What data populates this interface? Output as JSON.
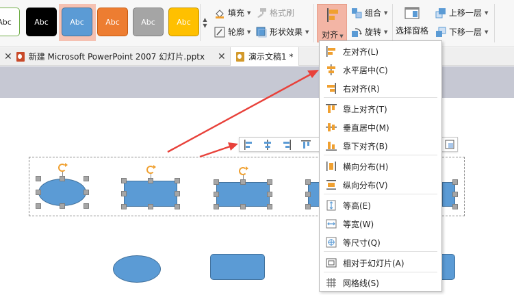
{
  "ribbon": {
    "style_tiles": [
      {
        "label": "Abc",
        "bg": "#ffffff",
        "fg": "#222222",
        "border": "#70ad47"
      },
      {
        "label": "Abc",
        "bg": "#000000",
        "fg": "#ffffff",
        "border": "#000000"
      },
      {
        "label": "Abc",
        "bg": "#5b9bd5",
        "fg": "#ffffff",
        "border": "#41719c"
      },
      {
        "label": "Abc",
        "bg": "#ed7d31",
        "fg": "#ffffff",
        "border": "#c55a11"
      },
      {
        "label": "Abc",
        "bg": "#a5a5a5",
        "fg": "#ffffff",
        "border": "#7f7f7f"
      },
      {
        "label": "Abc",
        "bg": "#ffc000",
        "fg": "#ffffff",
        "border": "#bf9000"
      }
    ],
    "fill": "填充",
    "format_brush": "格式刷",
    "outline": "轮廓",
    "shape_effects": "形状效果",
    "align": "对齐",
    "group": "组合",
    "rotate": "旋转",
    "selection_pane": "选择窗格",
    "bring_forward": "上移一层",
    "send_backward": "下移一层"
  },
  "tabs": [
    {
      "label": "新建 Microsoft PowerPoint 2007 幻灯片.pptx",
      "active": false
    },
    {
      "label": "演示文稿1 *",
      "active": true
    }
  ],
  "align_menu": {
    "items": [
      {
        "label": "左对齐(L)",
        "icon": "align-left-icon"
      },
      {
        "label": "水平居中(C)",
        "icon": "align-center-icon"
      },
      {
        "label": "右对齐(R)",
        "icon": "align-right-icon"
      },
      {
        "label": "靠上对齐(T)",
        "icon": "align-top-icon"
      },
      {
        "label": "垂直居中(M)",
        "icon": "align-middle-icon"
      },
      {
        "label": "靠下对齐(B)",
        "icon": "align-bottom-icon"
      },
      {
        "label": "横向分布(H)",
        "icon": "distribute-horizontal-icon"
      },
      {
        "label": "纵向分布(V)",
        "icon": "distribute-vertical-icon"
      },
      {
        "label": "等高(E)",
        "icon": "same-height-icon"
      },
      {
        "label": "等宽(W)",
        "icon": "same-width-icon"
      },
      {
        "label": "等尺寸(Q)",
        "icon": "same-size-icon"
      },
      {
        "label": "相对于幻灯片(A)",
        "icon": "relative-to-slide-icon"
      },
      {
        "label": "网格线(S)",
        "icon": "gridlines-icon"
      }
    ]
  },
  "colors": {
    "accent": "#f3b5a5",
    "shape_fill": "#5b9bd5",
    "icon_orange": "#f0a030",
    "arrow_red": "#e8413a"
  }
}
